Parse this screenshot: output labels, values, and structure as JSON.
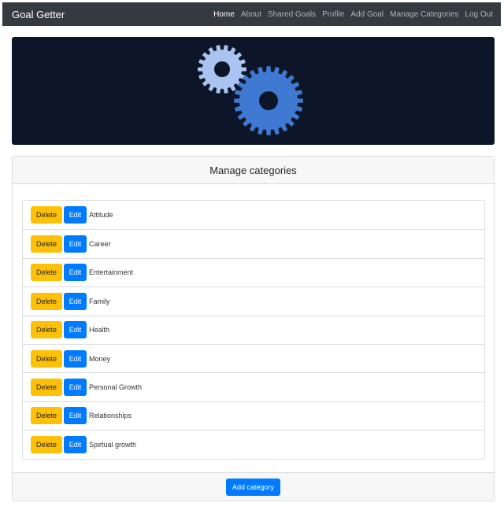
{
  "navbar": {
    "brand": "Goal Getter",
    "links": [
      "Home",
      "About",
      "Shared Goals",
      "Profile",
      "Add Goal",
      "Manage Categories",
      "Log Out"
    ]
  },
  "banner": {
    "icon": "gears-icon"
  },
  "card": {
    "title": "Manage categories",
    "delete_label": "Delete",
    "edit_label": "Edit",
    "categories": [
      "Attitude",
      "Career",
      "Entertainment",
      "Family",
      "Health",
      "Money",
      "Personal Growth",
      "Relationships",
      "Spirtual growth"
    ],
    "add_label": "Add category"
  },
  "colors": {
    "navbar": "#343a40",
    "banner": "#0d1629",
    "gear_light": "#a9c4f0",
    "gear_dark": "#3f79d1",
    "delete": "#ffc107",
    "edit": "#007bff"
  }
}
